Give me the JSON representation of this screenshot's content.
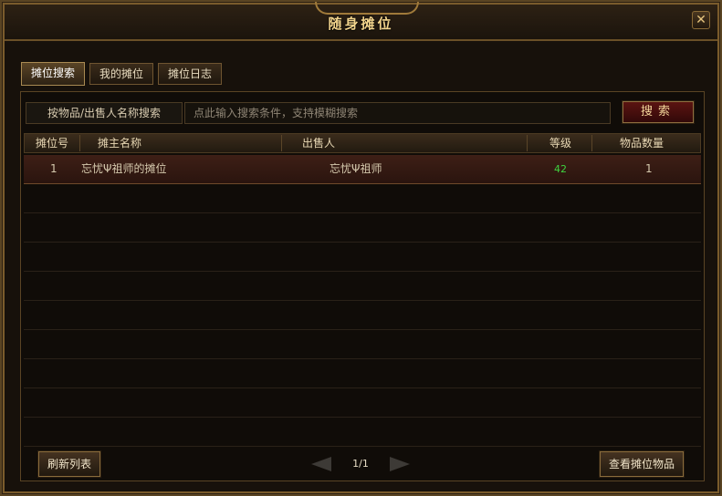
{
  "window": {
    "title": "随身摊位",
    "close_glyph": "✕"
  },
  "tabs": [
    {
      "label": "摊位搜索",
      "active": true
    },
    {
      "label": "我的摊位",
      "active": false
    },
    {
      "label": "摊位日志",
      "active": false
    }
  ],
  "search": {
    "label": "按物品/出售人名称搜索",
    "placeholder": "点此输入搜索条件，支持模糊搜索",
    "button_label": "搜索"
  },
  "table": {
    "headers": [
      "摊位号",
      "摊主名称",
      "出售人",
      "等级",
      "物品数量"
    ],
    "rows": [
      {
        "id": "1",
        "stall_name": "忘忧Ψ祖师的摊位",
        "seller": "忘忧Ψ祖师",
        "level": "42",
        "count": "1"
      }
    ]
  },
  "footer": {
    "refresh_label": "刷新列表",
    "page": "1/1",
    "view_items_label": "查看摊位物品"
  },
  "colors": {
    "accent_gold": "#f2d48c",
    "level_green": "#3fd23f",
    "search_button_red": "#5b1411"
  }
}
